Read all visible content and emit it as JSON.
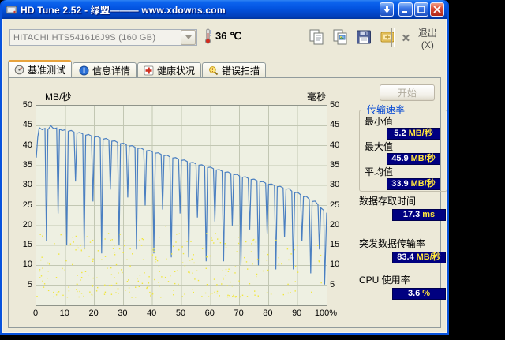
{
  "window": {
    "title": "HD Tune 2.52 - 绿盟——— www.xdowns.com"
  },
  "toolbar": {
    "drive_select": "HITACHI HTS541616J9S (160 GB)",
    "temperature": "36 ℃",
    "exit_label": "退出(X)"
  },
  "tabs": [
    {
      "label": "基准测试",
      "active": true
    },
    {
      "label": "信息详情",
      "active": false
    },
    {
      "label": "健康状况",
      "active": false
    },
    {
      "label": "错误扫描",
      "active": false
    }
  ],
  "panel": {
    "start_button": "开始",
    "transfer_group_title": "传输速率",
    "stats": [
      {
        "label": "最小值",
        "value": "5.2",
        "unit": "MB/秒"
      },
      {
        "label": "最大值",
        "value": "45.9",
        "unit": "MB/秒"
      },
      {
        "label": "平均值",
        "value": "33.9",
        "unit": "MB/秒"
      }
    ],
    "extra_stats": [
      {
        "label": "数据存取时间",
        "value": "17.3",
        "unit": "ms"
      },
      {
        "label": "突发数据传输率",
        "value": "83.4",
        "unit": "MB/秒"
      },
      {
        "label": "CPU 使用率",
        "value": "3.6",
        "unit": "%"
      }
    ]
  },
  "chart_data": {
    "type": "line+scatter",
    "title": "",
    "left_axis_label": "MB/秒",
    "right_axis_label": "毫秒",
    "xlim": [
      0,
      100
    ],
    "ylim": [
      0,
      50
    ],
    "x_ticks": [
      "0",
      "10",
      "20",
      "30",
      "40",
      "50",
      "60",
      "70",
      "80",
      "90",
      "100%"
    ],
    "y_ticks": [
      50,
      45,
      40,
      35,
      30,
      25,
      20,
      15,
      10,
      5
    ],
    "grid": true,
    "legend": "none",
    "colors": {
      "line": "#4a7fc1",
      "scatter": "#f0e63c",
      "grid": "#c2c7b3",
      "plot_bg": "#eef0e2",
      "badge_bg": "#000080"
    },
    "series": [
      {
        "name": "传输速率",
        "type": "line",
        "units": "MB/秒",
        "points": [
          [
            0,
            37
          ],
          [
            0.5,
            42
          ],
          [
            1,
            44.5
          ],
          [
            2,
            44
          ],
          [
            3,
            44.3
          ],
          [
            3.5,
            16
          ],
          [
            4,
            44
          ],
          [
            5,
            45
          ],
          [
            5.5,
            44.6
          ],
          [
            6,
            44.2
          ],
          [
            7,
            44.4
          ],
          [
            7.5,
            23
          ],
          [
            8,
            44.1
          ],
          [
            9,
            43.8
          ],
          [
            10,
            44
          ],
          [
            10.5,
            15
          ],
          [
            11,
            43.6
          ],
          [
            12,
            43.8
          ],
          [
            13,
            43.4
          ],
          [
            13.5,
            31
          ],
          [
            14,
            43.1
          ],
          [
            15,
            43.3
          ],
          [
            16,
            42.9
          ],
          [
            16.5,
            14
          ],
          [
            17,
            42.6
          ],
          [
            18,
            42.8
          ],
          [
            19,
            42.4
          ],
          [
            19.5,
            26
          ],
          [
            20,
            42.1
          ],
          [
            21,
            42.3
          ],
          [
            22,
            41.9
          ],
          [
            22.5,
            13
          ],
          [
            23,
            41.6
          ],
          [
            24,
            41.8
          ],
          [
            25,
            41.4
          ],
          [
            25.5,
            29
          ],
          [
            26,
            41.1
          ],
          [
            27,
            41.2
          ],
          [
            28,
            40.8
          ],
          [
            28.5,
            15
          ],
          [
            29,
            40.5
          ],
          [
            30,
            40.6
          ],
          [
            31,
            40.2
          ],
          [
            31.5,
            27
          ],
          [
            32,
            39.9
          ],
          [
            33,
            40
          ],
          [
            34,
            39.6
          ],
          [
            34.5,
            14
          ],
          [
            35,
            39.3
          ],
          [
            36,
            39.4
          ],
          [
            37,
            39
          ],
          [
            37.5,
            25
          ],
          [
            38,
            38.7
          ],
          [
            39,
            38.8
          ],
          [
            40,
            38.4
          ],
          [
            40.5,
            13
          ],
          [
            41,
            38.1
          ],
          [
            42,
            38.2
          ],
          [
            43,
            37.8
          ],
          [
            43.5,
            24
          ],
          [
            44,
            37.5
          ],
          [
            45,
            37.6
          ],
          [
            46,
            37.2
          ],
          [
            46.5,
            12
          ],
          [
            47,
            36.9
          ],
          [
            48,
            37
          ],
          [
            49,
            36.6
          ],
          [
            49.5,
            23
          ],
          [
            50,
            36.3
          ],
          [
            51,
            36.4
          ],
          [
            52,
            36
          ],
          [
            52.5,
            12
          ],
          [
            53,
            35.7
          ],
          [
            54,
            35.8
          ],
          [
            55,
            35.4
          ],
          [
            55.5,
            22
          ],
          [
            56,
            35.1
          ],
          [
            57,
            35.2
          ],
          [
            58,
            34.8
          ],
          [
            58.5,
            11
          ],
          [
            59,
            34.5
          ],
          [
            60,
            34.6
          ],
          [
            61,
            34.2
          ],
          [
            61.5,
            21
          ],
          [
            62,
            33.9
          ],
          [
            63,
            34
          ],
          [
            64,
            33.6
          ],
          [
            64.5,
            11
          ],
          [
            65,
            33.3
          ],
          [
            66,
            33.4
          ],
          [
            67,
            33
          ],
          [
            67.5,
            20
          ],
          [
            68,
            32.7
          ],
          [
            69,
            32.8
          ],
          [
            70,
            32.4
          ],
          [
            70.5,
            10
          ],
          [
            71,
            32.1
          ],
          [
            72,
            32.2
          ],
          [
            73,
            31.8
          ],
          [
            73.5,
            19
          ],
          [
            74,
            31.5
          ],
          [
            75,
            31.6
          ],
          [
            76,
            31.2
          ],
          [
            76.5,
            10
          ],
          [
            77,
            30.9
          ],
          [
            78,
            31
          ],
          [
            79,
            30.6
          ],
          [
            79.5,
            18
          ],
          [
            80,
            30.3
          ],
          [
            81,
            30.4
          ],
          [
            82,
            30
          ],
          [
            82.5,
            9
          ],
          [
            83,
            29.7
          ],
          [
            84,
            29.8
          ],
          [
            85,
            29.4
          ],
          [
            85.5,
            17
          ],
          [
            86,
            29.1
          ],
          [
            87,
            29.2
          ],
          [
            88,
            28.6
          ],
          [
            88.5,
            9
          ],
          [
            89,
            28.2
          ],
          [
            90,
            28.3
          ],
          [
            91,
            27.7
          ],
          [
            91.5,
            16
          ],
          [
            92,
            27.2
          ],
          [
            93,
            27.3
          ],
          [
            94,
            26.6
          ],
          [
            94.5,
            8
          ],
          [
            95,
            26
          ],
          [
            96,
            26.1
          ],
          [
            97,
            25.2
          ],
          [
            97.5,
            14
          ],
          [
            98,
            24.4
          ],
          [
            99,
            23.8
          ],
          [
            99.3,
            5.2
          ],
          [
            100,
            23.2
          ]
        ]
      },
      {
        "name": "存取时间",
        "type": "scatter",
        "units": "ms",
        "distribution": {
          "seed": 1337,
          "count": 340,
          "x_max": 100,
          "y_min": 2,
          "y_max": 18,
          "fade_after_x": 80,
          "note": "estimated random access-time dot cloud read from screenshot"
        }
      }
    ]
  }
}
